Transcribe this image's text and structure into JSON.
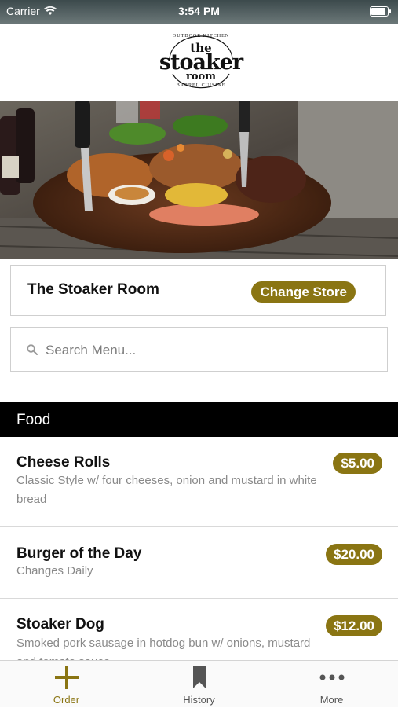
{
  "status_bar": {
    "carrier": "Carrier",
    "time": "3:54 PM"
  },
  "brand": {
    "arc_top": "OUTDOOR KITCHEN",
    "line1": "the",
    "line2": "stoaker",
    "line3": "room",
    "arc_bottom": "BARREL CUISINE"
  },
  "store": {
    "name": "The Stoaker Room",
    "change_label": "Change Store"
  },
  "search": {
    "placeholder": "Search Menu..."
  },
  "category": {
    "label": "Food"
  },
  "menu_items": [
    {
      "name": "Cheese Rolls",
      "description": "Classic Style w/ four cheeses, onion and mustard in white bread",
      "price": "$5.00"
    },
    {
      "name": "Burger of the Day",
      "description": "Changes Daily",
      "price": "$20.00"
    },
    {
      "name": "Stoaker Dog",
      "description": "Smoked pork sausage in hotdog bun w/ onions, mustard and tomato sauce",
      "price": "$12.00"
    }
  ],
  "tabs": [
    {
      "label": "Order",
      "icon": "plus-icon",
      "active": true
    },
    {
      "label": "History",
      "icon": "bookmark-icon",
      "active": false
    },
    {
      "label": "More",
      "icon": "more-dots-icon",
      "active": false
    }
  ],
  "colors": {
    "accent": "#8a7513",
    "category_bar": "#000000",
    "text_muted": "#8a8a8a"
  }
}
